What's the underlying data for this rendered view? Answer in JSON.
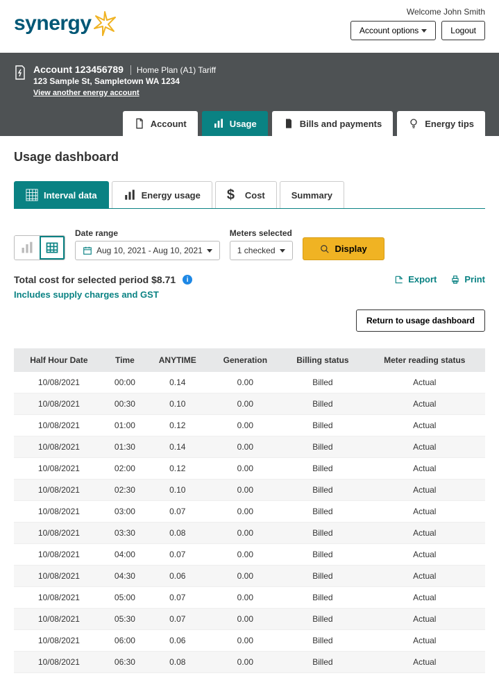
{
  "top": {
    "welcome": "Welcome John Smith",
    "account_options": "Account options",
    "logout": "Logout"
  },
  "banner": {
    "account_label": "Account",
    "account_number": "123456789",
    "plan": "Home Plan (A1) Tariff",
    "address": "123 Sample St, Sampletown WA 1234",
    "view_another": "View another energy account"
  },
  "nav": {
    "account": "Account",
    "usage": "Usage",
    "bills": "Bills and payments",
    "tips": "Energy tips"
  },
  "page_title": "Usage dashboard",
  "sub": {
    "interval": "Interval data",
    "energy": "Energy usage",
    "cost": "Cost",
    "summary": "Summary"
  },
  "filters": {
    "date_label": "Date range",
    "date_value": "Aug 10, 2021 - Aug 10, 2021",
    "meters_label": "Meters selected",
    "meters_value": "1 checked",
    "display": "Display"
  },
  "info": {
    "total_label": "Total cost for selected period",
    "total_amount": "$8.71",
    "supply_note": "Includes supply charges and GST",
    "export": "Export",
    "print": "Print",
    "return": "Return to usage dashboard"
  },
  "table": {
    "headers": [
      "Half Hour Date",
      "Time",
      "ANYTIME",
      "Generation",
      "Billing status",
      "Meter reading status"
    ],
    "rows": [
      [
        "10/08/2021",
        "00:00",
        "0.14",
        "0.00",
        "Billed",
        "Actual"
      ],
      [
        "10/08/2021",
        "00:30",
        "0.10",
        "0.00",
        "Billed",
        "Actual"
      ],
      [
        "10/08/2021",
        "01:00",
        "0.12",
        "0.00",
        "Billed",
        "Actual"
      ],
      [
        "10/08/2021",
        "01:30",
        "0.14",
        "0.00",
        "Billed",
        "Actual"
      ],
      [
        "10/08/2021",
        "02:00",
        "0.12",
        "0.00",
        "Billed",
        "Actual"
      ],
      [
        "10/08/2021",
        "02:30",
        "0.10",
        "0.00",
        "Billed",
        "Actual"
      ],
      [
        "10/08/2021",
        "03:00",
        "0.07",
        "0.00",
        "Billed",
        "Actual"
      ],
      [
        "10/08/2021",
        "03:30",
        "0.08",
        "0.00",
        "Billed",
        "Actual"
      ],
      [
        "10/08/2021",
        "04:00",
        "0.07",
        "0.00",
        "Billed",
        "Actual"
      ],
      [
        "10/08/2021",
        "04:30",
        "0.06",
        "0.00",
        "Billed",
        "Actual"
      ],
      [
        "10/08/2021",
        "05:00",
        "0.07",
        "0.00",
        "Billed",
        "Actual"
      ],
      [
        "10/08/2021",
        "05:30",
        "0.07",
        "0.00",
        "Billed",
        "Actual"
      ],
      [
        "10/08/2021",
        "06:00",
        "0.06",
        "0.00",
        "Billed",
        "Actual"
      ],
      [
        "10/08/2021",
        "06:30",
        "0.08",
        "0.00",
        "Billed",
        "Actual"
      ]
    ]
  }
}
